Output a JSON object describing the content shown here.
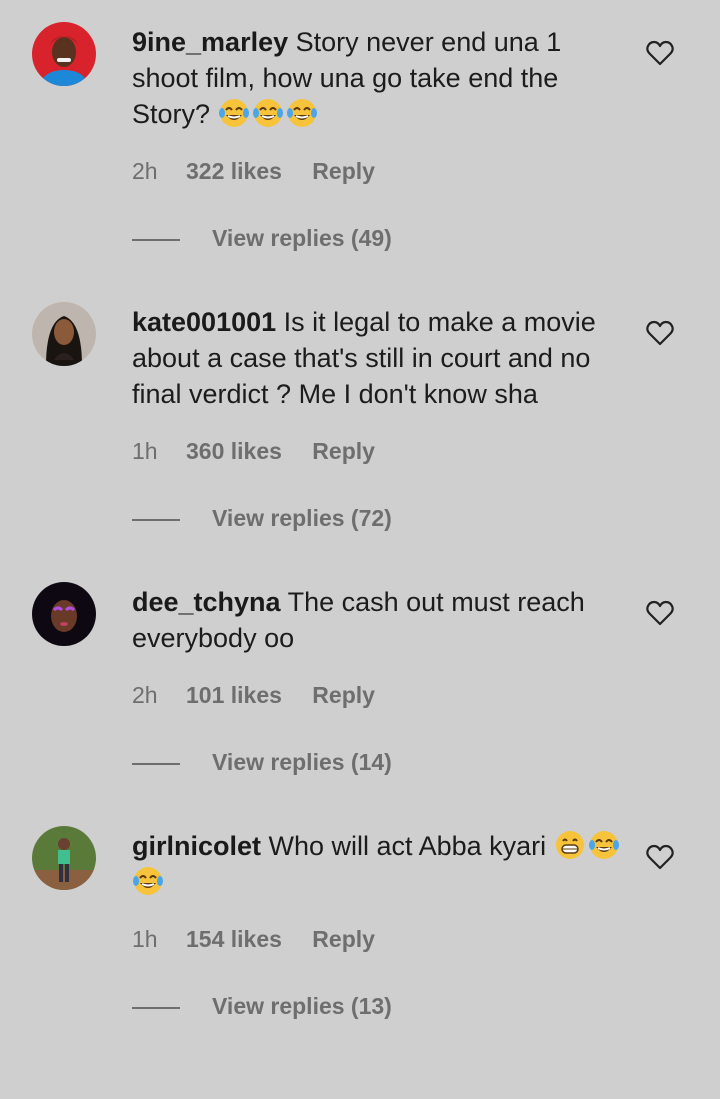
{
  "comments": [
    {
      "username": "9ine_marley",
      "text": "Story never end una 1 shoot film, how una go take end the Story?",
      "emojis": [
        "laughing-tears",
        "laughing-tears",
        "laughing-tears"
      ],
      "time": "2h",
      "likes": "322 likes",
      "reply_label": "Reply",
      "view_replies": "View replies (49)",
      "avatar_colors": [
        "#d8232d",
        "#2a1a12"
      ]
    },
    {
      "username": "kate001001",
      "text": "Is it legal to make a movie about a case that's still in court and no final verdict ? Me I don't know sha",
      "emojis": [],
      "time": "1h",
      "likes": "360 likes",
      "reply_label": "Reply",
      "view_replies": "View replies (72)",
      "avatar_colors": [
        "#bdb5ae",
        "#1a1410"
      ]
    },
    {
      "username": "dee_tchyna",
      "text": "The cash out must reach everybody oo",
      "emojis": [],
      "time": "2h",
      "likes": "101 likes",
      "reply_label": "Reply",
      "view_replies": "View replies (14)",
      "avatar_colors": [
        "#0e0812",
        "#7a3aa0"
      ]
    },
    {
      "username": "girlnicolet",
      "text": "Who will act Abba kyari",
      "emojis": [
        "grinning",
        "laughing-tears",
        "laughing-tears"
      ],
      "time": "1h",
      "likes": "154 likes",
      "reply_label": "Reply",
      "view_replies": "View replies (13)",
      "avatar_colors": [
        "#5a7a3a",
        "#c09060"
      ]
    }
  ]
}
